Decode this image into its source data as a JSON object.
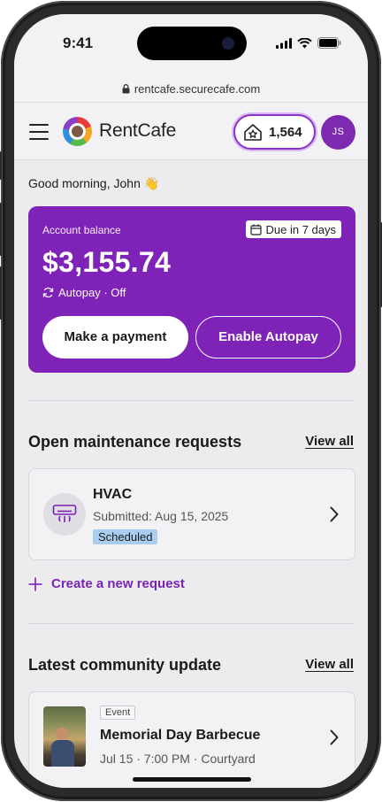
{
  "status_bar": {
    "time": "9:41"
  },
  "browser": {
    "url": "rentcafe.securecafe.com"
  },
  "header": {
    "brand": "RentCafe",
    "points": "1,564",
    "avatar_initials": "JS"
  },
  "greeting": "Good morning, John 👋",
  "balance": {
    "label": "Account balance",
    "due": "Due in 7 days",
    "amount": "$3,155.74",
    "autopay_status": "Autopay · Off",
    "pay_button": "Make a payment",
    "autopay_button": "Enable Autopay"
  },
  "maintenance": {
    "title": "Open maintenance requests",
    "view_all": "View all",
    "request": {
      "title": "HVAC",
      "submitted": "Submitted: Aug 15, 2025",
      "status": "Scheduled"
    },
    "create_label": "Create a new request"
  },
  "community": {
    "title": "Latest community update",
    "view_all": "View all",
    "item": {
      "tag": "Event",
      "title": "Memorial Day Barbecue",
      "details": "Jul 15 · 7:00 PM · Courtyard"
    }
  },
  "colors": {
    "brand_purple": "#7e22b8",
    "status_badge": "#a9cdef",
    "link": "#7b22b4"
  }
}
